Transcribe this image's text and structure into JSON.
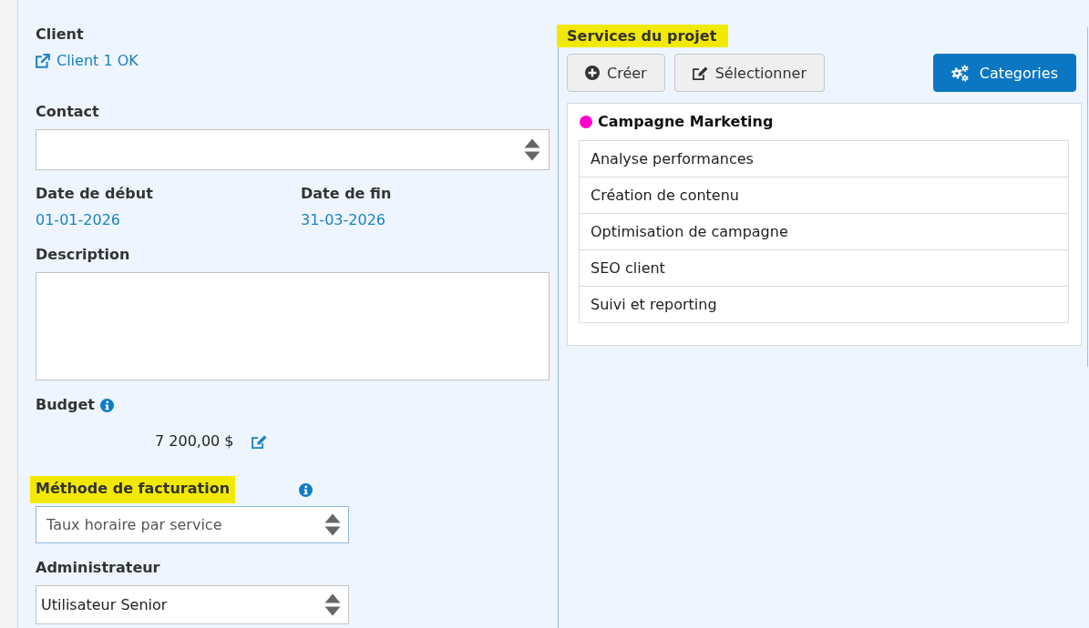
{
  "client": {
    "label": "Client",
    "link": "Client 1 OK"
  },
  "contact": {
    "label": "Contact"
  },
  "dates": [
    {
      "label": "Date de début",
      "value": "01-01-2026"
    },
    {
      "label": "Date de fin",
      "value": "31-03-2026"
    }
  ],
  "description": {
    "label": "Description"
  },
  "budget": {
    "label": "Budget",
    "amount": "7 200,00 $"
  },
  "billing_method": {
    "label": "Méthode de facturation",
    "highlighted": true,
    "value": "Taux horaire par service",
    "focused": true
  },
  "administrator": {
    "label": "Administrateur",
    "value": "Utilisateur Senior"
  },
  "services": {
    "title": "Services du projet",
    "highlighted": true,
    "buttons": [
      {
        "label": "Créer",
        "kind": "create"
      },
      {
        "label": "Sélectionner",
        "kind": "select"
      },
      {
        "label": "Categories",
        "kind": "categories"
      }
    ],
    "groups": [
      {
        "name": "Campagne Marketing",
        "color": "#ff00cc",
        "items": [
          "Analyse performances",
          "Création de contenu",
          "Optimisation de campagne",
          "SEO client",
          "Suivi et reporting"
        ]
      }
    ]
  }
}
